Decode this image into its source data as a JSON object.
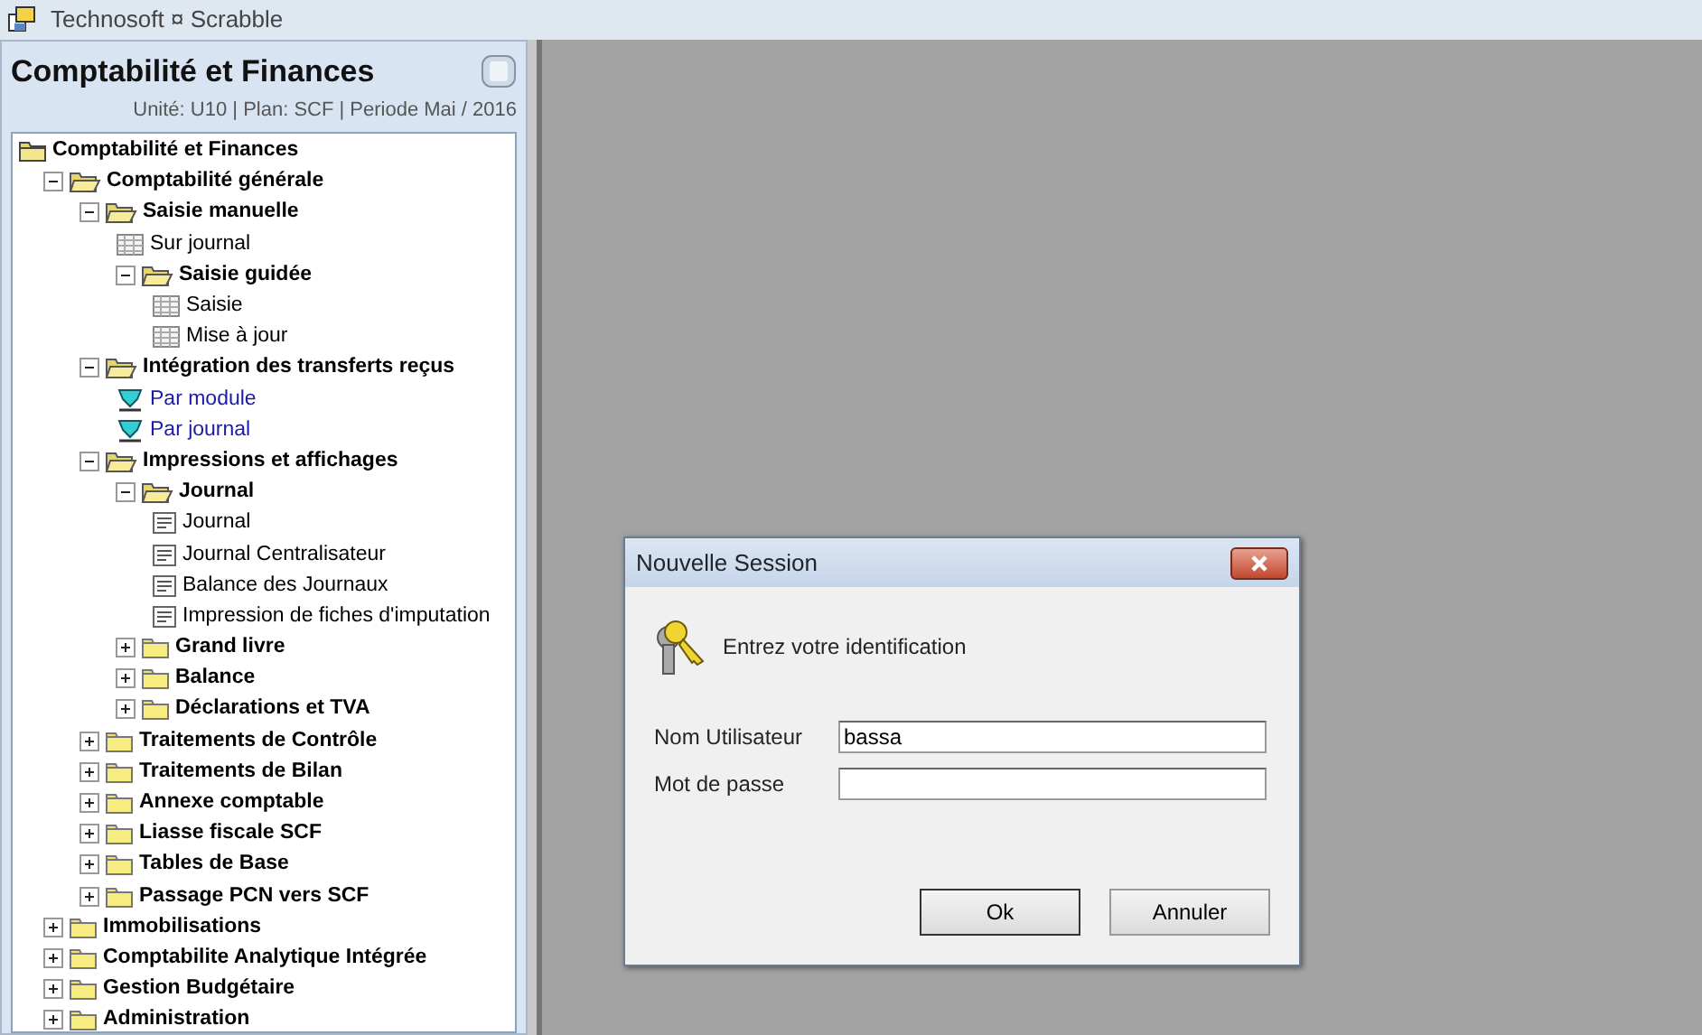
{
  "window": {
    "title": "Technosoft ¤ Scrabble"
  },
  "panel": {
    "title": "Comptabilité et Finances",
    "subtitle": "Unité: U10 | Plan: SCF | Periode Mai / 2016"
  },
  "tree": [
    {
      "label": "Comptabilité et Finances",
      "kind": "root",
      "children": [
        {
          "label": "Comptabilité générale",
          "kind": "folder",
          "expanded": true,
          "children": [
            {
              "label": "Saisie manuelle",
              "kind": "folder",
              "expanded": true,
              "children": [
                {
                  "label": "Sur journal",
                  "kind": "form"
                },
                {
                  "label": "Saisie guidée",
                  "kind": "folder",
                  "expanded": true,
                  "children": [
                    {
                      "label": "Saisie",
                      "kind": "form"
                    },
                    {
                      "label": "Mise à jour",
                      "kind": "form"
                    }
                  ]
                }
              ]
            },
            {
              "label": "Intégration des transferts reçus",
              "kind": "folder",
              "expanded": true,
              "children": [
                {
                  "label": "Par module",
                  "kind": "transfer"
                },
                {
                  "label": "Par journal",
                  "kind": "transfer"
                }
              ]
            },
            {
              "label": "Impressions et affichages",
              "kind": "folder",
              "expanded": true,
              "children": [
                {
                  "label": "Journal",
                  "kind": "folder",
                  "expanded": true,
                  "children": [
                    {
                      "label": "Journal",
                      "kind": "report"
                    },
                    {
                      "label": "Journal Centralisateur",
                      "kind": "report"
                    },
                    {
                      "label": "Balance des Journaux",
                      "kind": "report"
                    },
                    {
                      "label": "Impression de fiches d'imputation",
                      "kind": "report"
                    }
                  ]
                },
                {
                  "label": "Grand livre",
                  "kind": "folder",
                  "expanded": false
                },
                {
                  "label": "Balance",
                  "kind": "folder",
                  "expanded": false
                },
                {
                  "label": "Déclarations et TVA",
                  "kind": "folder",
                  "expanded": false
                }
              ]
            },
            {
              "label": "Traitements de Contrôle",
              "kind": "folder",
              "expanded": false
            },
            {
              "label": "Traitements de Bilan",
              "kind": "folder",
              "expanded": false
            },
            {
              "label": "Annexe comptable",
              "kind": "folder",
              "expanded": false
            },
            {
              "label": "Liasse fiscale SCF",
              "kind": "folder",
              "expanded": false
            },
            {
              "label": "Tables de Base",
              "kind": "folder",
              "expanded": false
            },
            {
              "label": "Passage PCN vers SCF",
              "kind": "folder",
              "expanded": false
            }
          ]
        },
        {
          "label": "Immobilisations",
          "kind": "folder",
          "expanded": false
        },
        {
          "label": "Comptabilite Analytique Intégrée",
          "kind": "folder",
          "expanded": false
        },
        {
          "label": "Gestion Budgétaire",
          "kind": "folder",
          "expanded": false
        },
        {
          "label": "Administration",
          "kind": "folder",
          "expanded": false
        }
      ]
    }
  ],
  "dialog": {
    "title": "Nouvelle Session",
    "message": "Entrez votre identification",
    "fields": [
      {
        "label": "Nom Utilisateur",
        "value": "bassa"
      },
      {
        "label": "Mot de passe"
      }
    ],
    "buttons": [
      {
        "label": "Ok",
        "default": true
      },
      {
        "label": "Annuler",
        "default": false
      }
    ]
  }
}
